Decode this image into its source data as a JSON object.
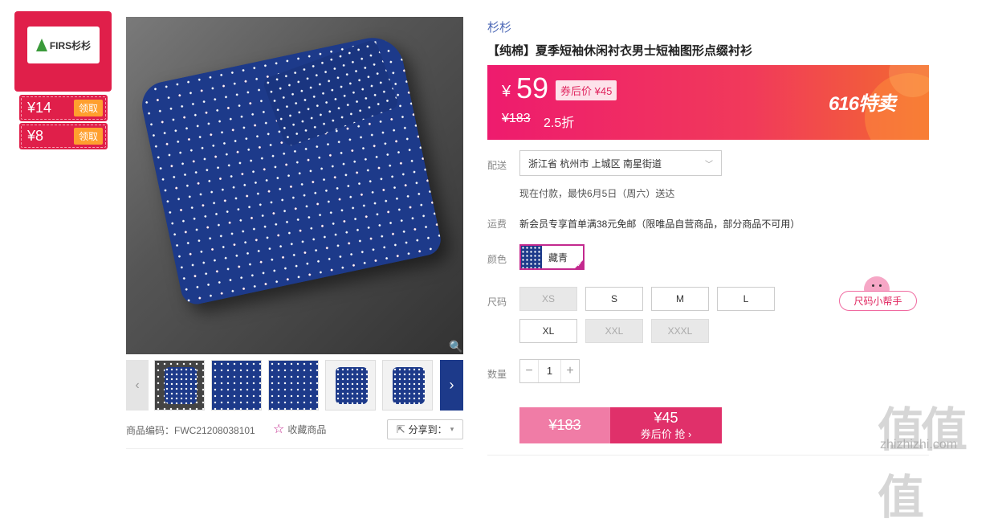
{
  "brand_card": {
    "logo_text": "FIRS杉杉",
    "coupons": [
      {
        "amount": "¥14",
        "claim": "领取"
      },
      {
        "amount": "¥8",
        "claim": "领取"
      }
    ]
  },
  "gallery": {
    "prev_arrow": "‹",
    "next_arrow": "›",
    "zoom_icon": "🔍"
  },
  "product": {
    "brand": "杉杉",
    "title": "【纯棉】夏季短袖休闲衬衣男士短袖图形点缀衬衫",
    "code_label": "商品编码：FWC21208038101",
    "favorite_label": "收藏商品",
    "share_label": "分享到："
  },
  "price": {
    "currency": "¥",
    "value": "59",
    "after_coupon": "券后价 ¥45",
    "original": "¥183",
    "discount": "2.5折",
    "promo": "616特卖"
  },
  "delivery": {
    "label": "配送",
    "address": "浙江省 杭州市 上城区 南星街道",
    "eta": "现在付款，最快6月5日（周六）送达"
  },
  "shipping": {
    "label": "运费",
    "text": "新会员专享首单满38元免邮（限唯品自营商品，部分商品不可用）"
  },
  "color": {
    "label": "颜色",
    "selected": "藏青"
  },
  "size": {
    "label": "尺码",
    "options": [
      {
        "name": "XS",
        "available": false
      },
      {
        "name": "S",
        "available": true
      },
      {
        "name": "M",
        "available": true
      },
      {
        "name": "L",
        "available": true
      },
      {
        "name": "XL",
        "available": true
      },
      {
        "name": "XXL",
        "available": false
      },
      {
        "name": "XXXL",
        "available": false
      }
    ],
    "helper": "尺码小帮手"
  },
  "quantity": {
    "label": "数量",
    "value": "1",
    "minus": "−",
    "plus": "+"
  },
  "buy": {
    "original": "¥183",
    "price": "¥45",
    "action": "券后价 抢 ›"
  },
  "watermark": {
    "text": "值值值",
    "url": "zhizhizhi.com"
  },
  "colors": {
    "accent": "#e0245e",
    "promo_gradient_start": "#ee1b6e",
    "promo_gradient_end": "#f36a2f",
    "selected_border": "#c3298e"
  }
}
